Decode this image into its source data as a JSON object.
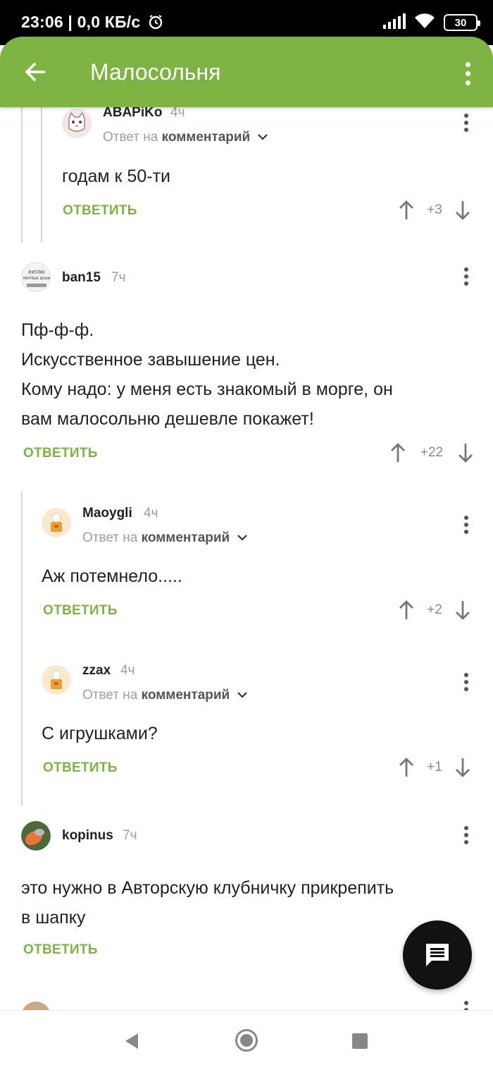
{
  "status_bar": {
    "time": "23:06 | 0,0 КБ/с",
    "battery": "30"
  },
  "app_bar": {
    "title": "Малосольня"
  },
  "labels": {
    "reply_to": "Ответ на",
    "reply_to_target": "комментарий",
    "reply_button": "ОТВЕТИТЬ"
  },
  "comments": [
    {
      "user": "ABAPiKo",
      "time": "4ч",
      "is_reply": true,
      "text": "годам к 50-ти",
      "score": "+3"
    },
    {
      "user": "ban15",
      "time": "7ч",
      "is_reply": false,
      "text_lines": [
        "Пф-ф-ф.",
        "Искусственное завышение цен.",
        "Кому надо: у меня есть знакомый в морге, он",
        "вам малосольню дешевле покажет!"
      ],
      "score": "+22"
    },
    {
      "user": "Maoygli",
      "time": "4ч",
      "is_reply": true,
      "text": "Аж потемнело.....",
      "score": "+2"
    },
    {
      "user": "zzax",
      "time": "4ч",
      "is_reply": true,
      "text": "С игрушками?",
      "score": "+1"
    },
    {
      "user": "kopinus",
      "time": "7ч",
      "is_reply": false,
      "text_lines": [
        "это нужно в Авторскую клубничку прикрепить",
        "в шапку"
      ]
    }
  ],
  "avatar_text": {
    "ban15": "КУПЛЮ МЕРТВЫЕ ДУШИ"
  },
  "colors": {
    "accent": "#7cb342",
    "fab": "#111111"
  },
  "icons": {
    "back": "arrow-left-icon",
    "menu": "more-vert-icon",
    "fab": "comment-icon"
  }
}
